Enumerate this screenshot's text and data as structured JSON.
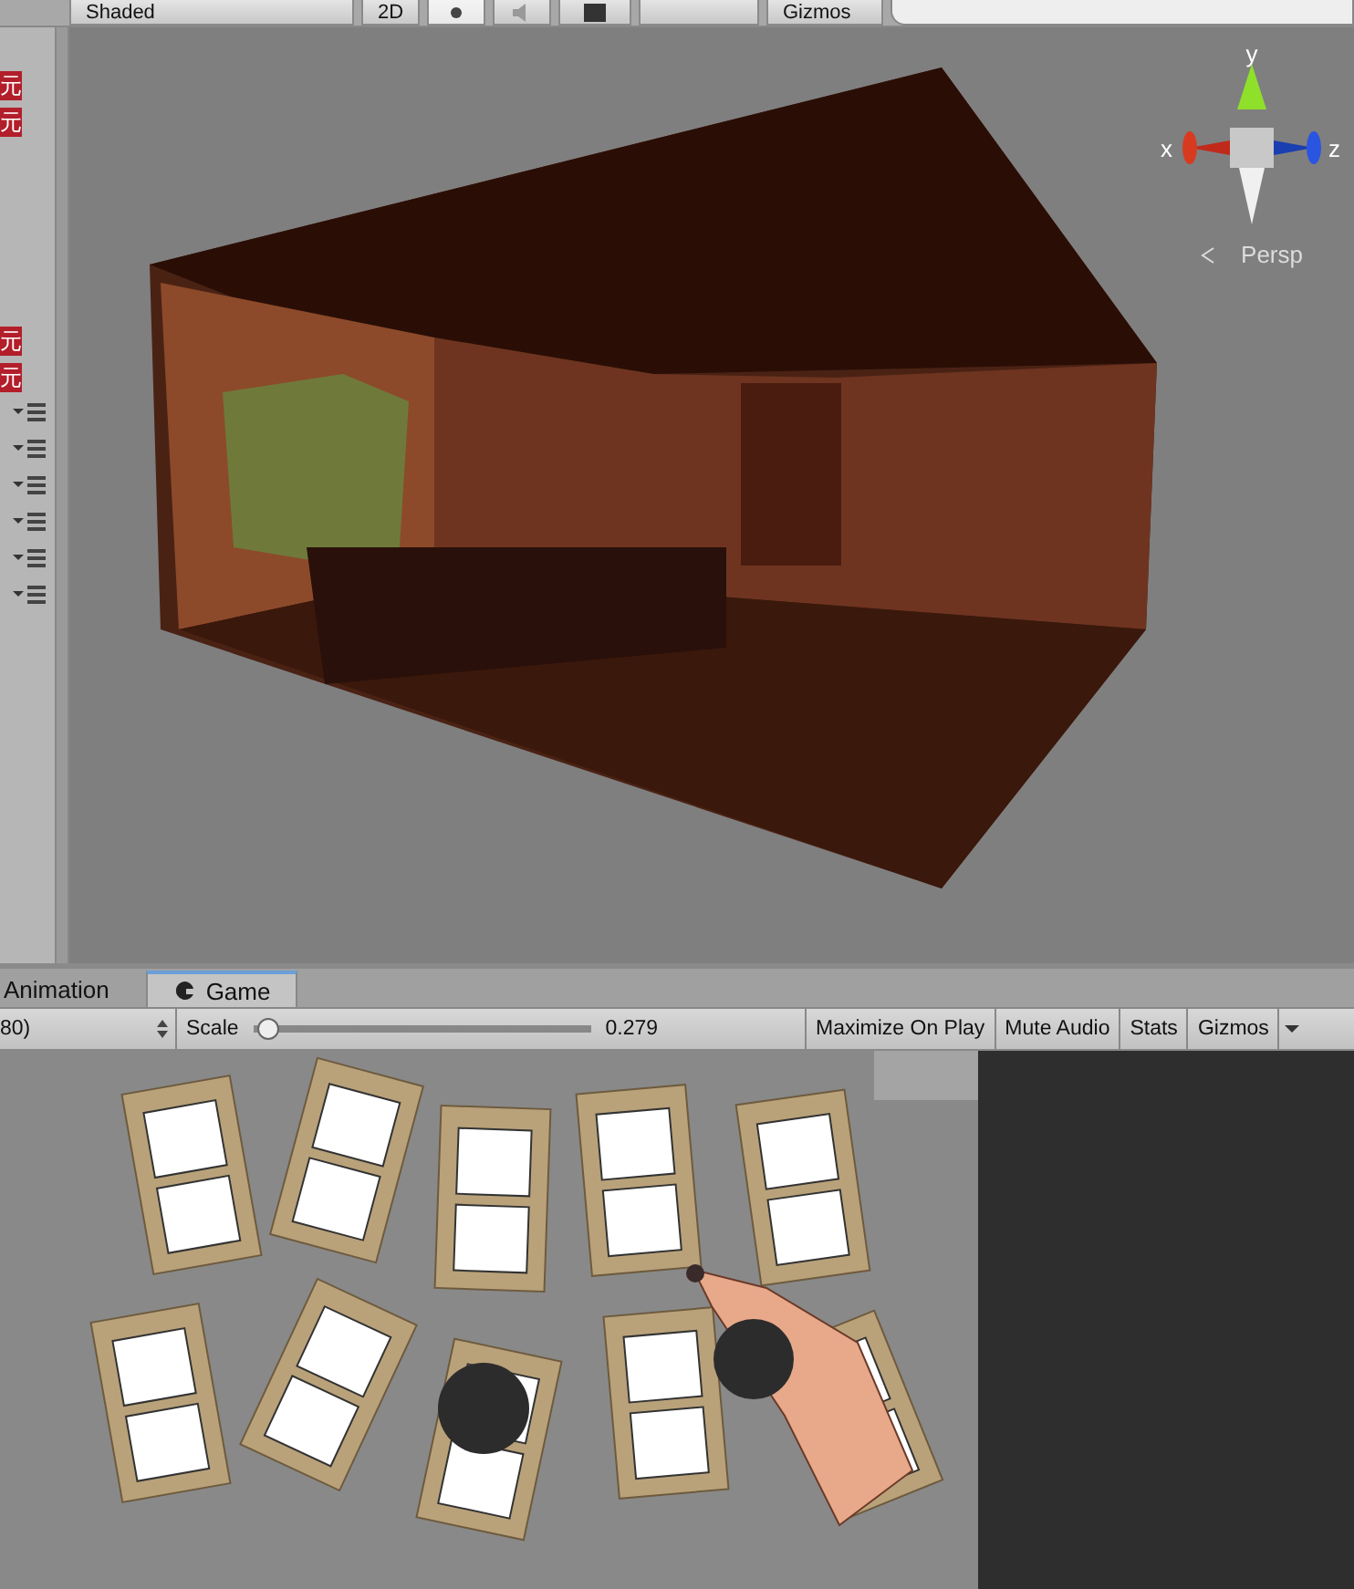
{
  "scene_toolbar": {
    "shading_mode": "Shaded",
    "mode_2d": "2D",
    "gizmos": "Gizmos"
  },
  "scene_toolbar_toggles": [
    {
      "kind": "lighting",
      "on": true
    },
    {
      "kind": "audio",
      "on": false
    },
    {
      "kind": "effects",
      "on": false
    }
  ],
  "hierarchy": {
    "badges": [
      "元",
      "元",
      "元",
      "元"
    ]
  },
  "scene_gizmo": {
    "x_label": "x",
    "y_label": "y",
    "z_label": "z",
    "projection": "Persp"
  },
  "tabs": [
    {
      "label": "Animation",
      "selected": false
    },
    {
      "label": "Game",
      "selected": true
    }
  ],
  "game_toolbar": {
    "resolution": "80)",
    "scale_label": "Scale",
    "scale": {
      "level": 0.02
    },
    "scale_reading": "0.279",
    "buttons": [
      {
        "label": "Maximize On Play",
        "on": false
      },
      {
        "label": "Mute Audio",
        "on": false
      },
      {
        "label": "Stats",
        "on": false
      },
      {
        "label": "Gizmos",
        "on": false
      }
    ]
  }
}
